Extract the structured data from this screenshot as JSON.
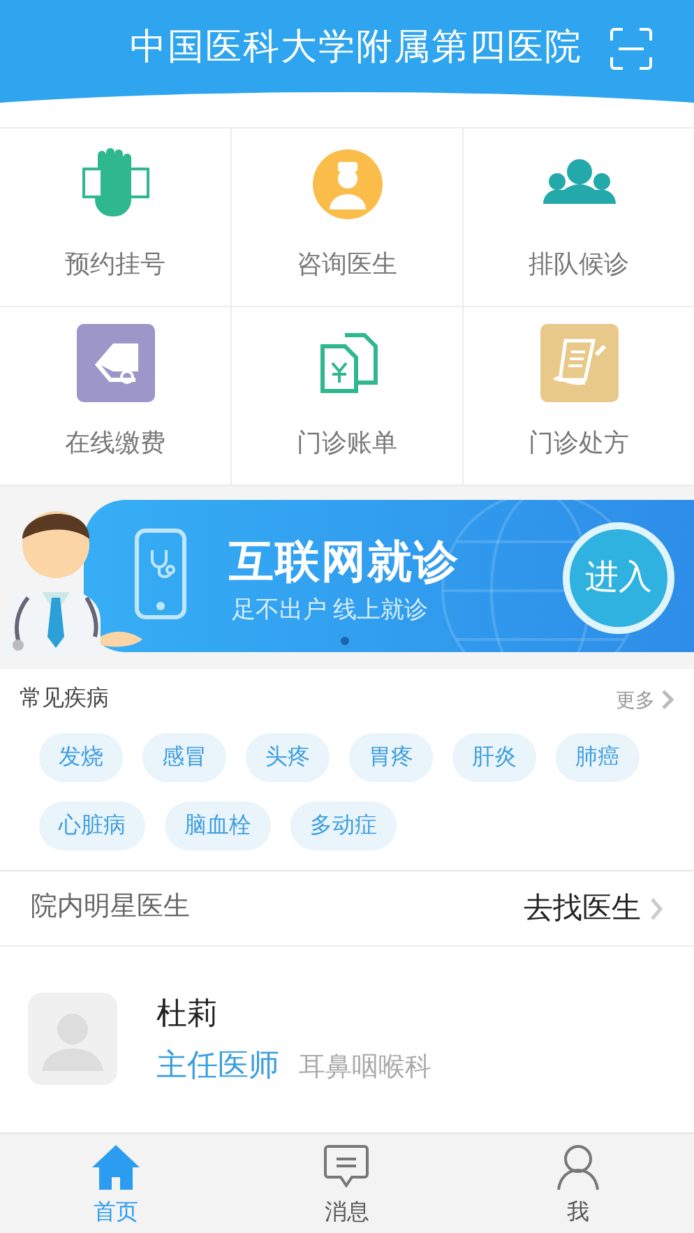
{
  "header": {
    "title": "中国医科大学附属第四医院"
  },
  "services": [
    {
      "label": "预约挂号"
    },
    {
      "label": "咨询医生"
    },
    {
      "label": "排队候诊"
    },
    {
      "label": "在线缴费"
    },
    {
      "label": "门诊账单"
    },
    {
      "label": "门诊处方"
    }
  ],
  "banner": {
    "title": "互联网就诊",
    "subtitle": "足不出户 线上就诊",
    "button": "进入"
  },
  "diseases": {
    "title": "常见疾病",
    "more": "更多",
    "tags": [
      "发烧",
      "感冒",
      "头疼",
      "胃疼",
      "肝炎",
      "肺癌",
      "心脏病",
      "脑血栓",
      "多动症"
    ]
  },
  "doctors": {
    "title": "院内明星医生",
    "link": "去找医生",
    "items": [
      {
        "name": "杜莉",
        "rank": "主任医师",
        "department": "耳鼻咽喉科"
      }
    ]
  },
  "tabs": [
    {
      "label": "首页",
      "selected": true
    },
    {
      "label": "消息",
      "selected": false
    },
    {
      "label": "我",
      "selected": false
    }
  ]
}
